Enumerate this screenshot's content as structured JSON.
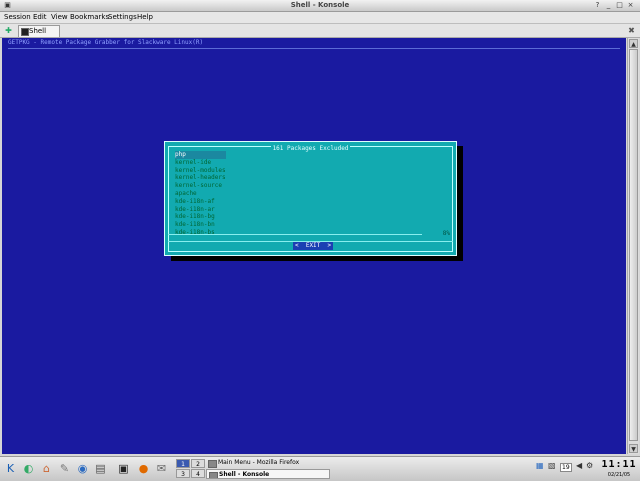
{
  "window": {
    "title": "Shell - Konsole",
    "controls": [
      "?",
      "_",
      "□",
      "×"
    ]
  },
  "menu": [
    "Session",
    "Edit",
    "View",
    "Bookmarks",
    "Settings",
    "Help"
  ],
  "tabs": [
    {
      "label": "Shell"
    }
  ],
  "terminal": {
    "header": "GETPKG - Remote Package Grabber for Slackware Linux(R)",
    "background": "#1a1aa0"
  },
  "dialog": {
    "title": "161 Packages Excluded",
    "items": [
      "php",
      "kernel-ide",
      "kernel-modules",
      "kernel-headers",
      "kernel-source",
      "apache",
      "kde-i18n-af",
      "kde-i18n-ar",
      "kde-i18n-bg",
      "kde-i18n-bn",
      "kde-i18n-bs"
    ],
    "progress_label": "8%",
    "progress": 0.08,
    "exit_label": "<  EXIT  >",
    "background": "#12aab0"
  },
  "taskbar": {
    "pager": [
      "1",
      "2",
      "3",
      "4"
    ],
    "tasks": [
      "Main Menu - Mozilla Firefox",
      "Shell - Konsole"
    ],
    "tray_number": "19",
    "clock_time": "11:11",
    "clock_date": "02/21/05",
    "launcher_icons": [
      "kde-menu-icon",
      "network-icon",
      "home-icon",
      "tools-icon",
      "help-icon",
      "print-icon",
      "terminal-icon",
      "firefox-icon",
      "email-icon",
      "desktop-icon"
    ]
  }
}
